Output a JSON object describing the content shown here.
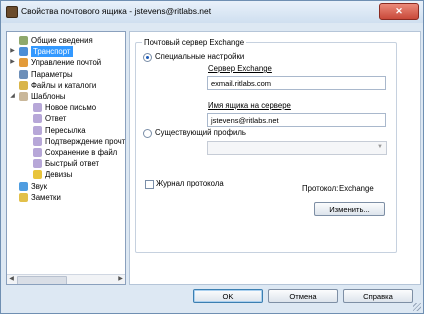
{
  "window": {
    "title": "Свойства почтового ящика - jstevens@ritlabs.net",
    "close_glyph": "✕"
  },
  "tree": {
    "items": [
      {
        "label": "Общие сведения",
        "icon_color": "#8fa86b",
        "expander": ""
      },
      {
        "label": "Транспорт",
        "icon_color": "#4d8ed6",
        "expander": "▶"
      },
      {
        "label": "Управление почтой",
        "icon_color": "#e39b3a",
        "expander": "▶"
      },
      {
        "label": "Параметры",
        "icon_color": "#6d8fb9",
        "expander": ""
      },
      {
        "label": "Файлы и каталоги",
        "icon_color": "#d9b54a",
        "expander": ""
      },
      {
        "label": "Шаблоны",
        "icon_color": "#c9b79a",
        "expander": "◢"
      },
      {
        "label": "Новое письмо",
        "icon_color": "#b7a7d8",
        "expander": ""
      },
      {
        "label": "Ответ",
        "icon_color": "#b7a7d8",
        "expander": ""
      },
      {
        "label": "Пересылка",
        "icon_color": "#b7a7d8",
        "expander": ""
      },
      {
        "label": "Подтверждение прочтения",
        "icon_color": "#b7a7d8",
        "expander": ""
      },
      {
        "label": "Сохранение в файл",
        "icon_color": "#b7a7d8",
        "expander": ""
      },
      {
        "label": "Быстрый ответ",
        "icon_color": "#b7a7d8",
        "expander": ""
      },
      {
        "label": "Девизы",
        "icon_color": "#e8c43b",
        "expander": ""
      },
      {
        "label": "Звук",
        "icon_color": "#4f9de0",
        "expander": ""
      },
      {
        "label": "Заметки",
        "icon_color": "#e2c04a",
        "expander": ""
      }
    ],
    "selected_index": 1,
    "scroll_left": "◀",
    "scroll_right": "▶"
  },
  "exchange": {
    "group_title": "Почтовый сервер Exchange",
    "special_settings": "Специальные настройки",
    "server_label": "Сервер Exchange",
    "server_value": "exmail.ritlabs.com",
    "mailbox_label": "Имя ящика на сервере",
    "mailbox_value": "jstevens@ritlabs.net",
    "existing_profile": "Существующий профиль",
    "combo_arrow": "▼",
    "log_label": "Журнал протокола",
    "protocol_label": "Протокол:",
    "protocol_value": "Exchange",
    "change_button": "Изменить..."
  },
  "footer": {
    "ok": "OK",
    "cancel": "Отмена",
    "help": "Справка"
  }
}
